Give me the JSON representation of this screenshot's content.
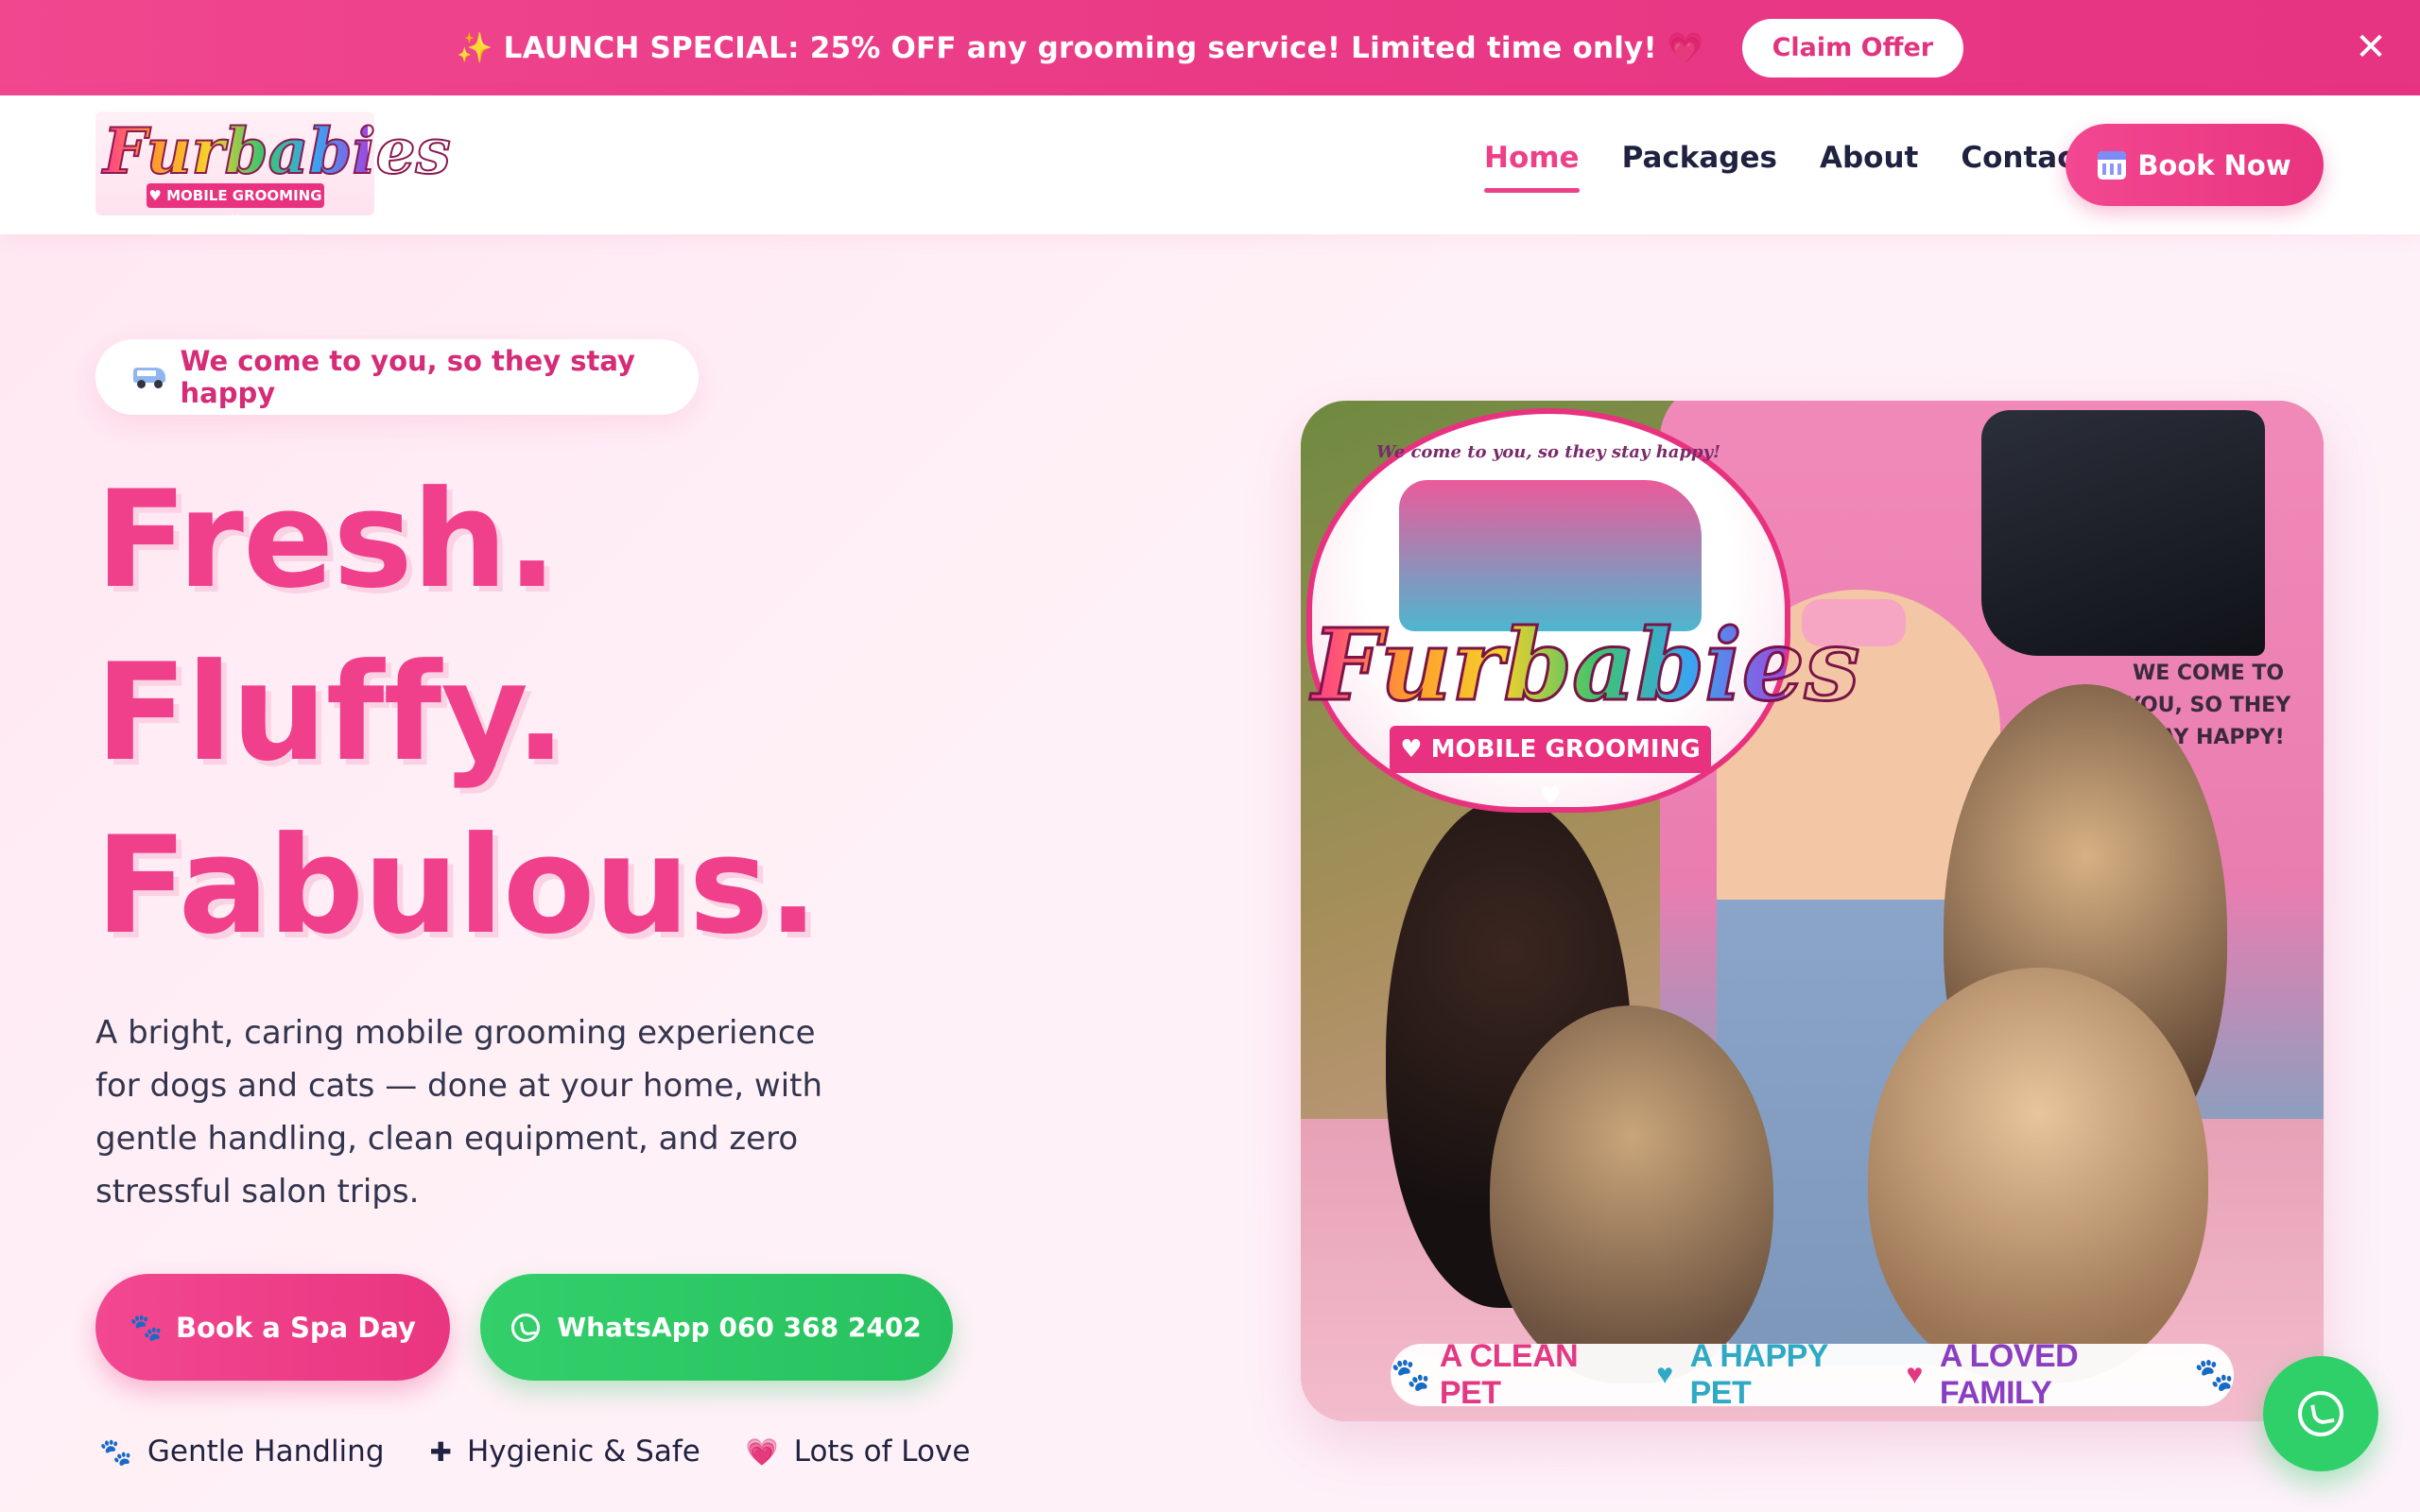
{
  "promo": {
    "text": "✨ LAUNCH SPECIAL: 25% OFF any grooming service! Limited time only! 💗",
    "button_label": "Claim Offer",
    "close_glyph": "✕"
  },
  "header": {
    "logo_word": "Furbabies",
    "logo_sub": "♥ MOBILE GROOMING ♥",
    "nav": [
      {
        "label": "Home",
        "active": true
      },
      {
        "label": "Packages",
        "active": false
      },
      {
        "label": "About",
        "active": false
      },
      {
        "label": "Contact",
        "active": false
      }
    ],
    "book_now_label": "Book Now",
    "book_now_icon": "calendar-icon"
  },
  "hero": {
    "pill_text": "We come to you, so they stay happy",
    "pill_icon": "van-icon",
    "headline": [
      "Fresh.",
      "Fluffy.",
      "Fabulous."
    ],
    "description": "A bright, caring mobile grooming experience for dogs and cats — done at your home, with gentle handling, clean equipment, and zero stressful salon trips.",
    "primary_cta": "Book a Spa Day",
    "primary_cta_icon": "🐾",
    "secondary_cta": "WhatsApp 060 368 2402",
    "secondary_cta_icon": "whatsapp-icon",
    "features": [
      {
        "icon": "🐾",
        "label": "Gentle Handling"
      },
      {
        "icon": "✚",
        "label": "Hygienic & Safe"
      },
      {
        "icon": "💗",
        "label": "Lots of Love"
      }
    ]
  },
  "hero_image": {
    "badge_top_text": "We come to you, so they stay happy!",
    "badge_word": "Furbabies",
    "badge_ribbon": "♥ MOBILE GROOMING ♥",
    "van_text": "WE COME TO YOU, SO THEY STAY HAPPY!",
    "tagline": {
      "part1": "A CLEAN PET",
      "part2": "A HAPPY PET",
      "part3": "A LOVED FAMILY",
      "paw": "🐾",
      "heart_teal": "♥",
      "heart_pink": "♥"
    }
  },
  "floating_button": {
    "icon": "whatsapp-icon"
  },
  "colors": {
    "brand_pink": "#ec4189",
    "whatsapp_green": "#2fcf6a",
    "text_dark": "#1f2240"
  }
}
